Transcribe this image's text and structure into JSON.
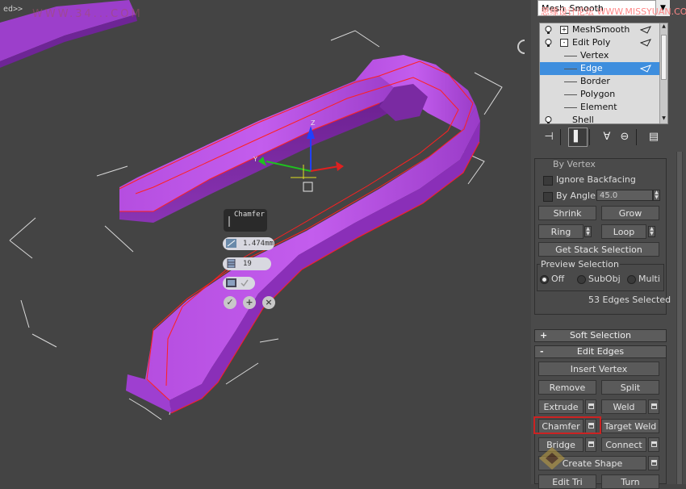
{
  "viewport": {
    "label": "ed>>",
    "watermark": "WWW.34...COM",
    "caddy": {
      "title": "Chamfer",
      "amount": "1.474mm",
      "segments": "19"
    }
  },
  "panel": {
    "name_box": "Mesh_Smooth",
    "watermark": "思缘设计论坛 WWW.MISSYUAN.COM",
    "stack": [
      {
        "label": "MeshSmooth",
        "level": 0,
        "pm": "+",
        "bulb": true,
        "pin": true
      },
      {
        "label": "Edit Poly",
        "level": 0,
        "pm": "-",
        "bulb": true,
        "pin": true
      },
      {
        "label": "Vertex",
        "level": 1
      },
      {
        "label": "Edge",
        "level": 1,
        "selected": true,
        "pin": true
      },
      {
        "label": "Border",
        "level": 1
      },
      {
        "label": "Polygon",
        "level": 1
      },
      {
        "label": "Element",
        "level": 1
      },
      {
        "label": "Shell",
        "level": 0,
        "bulb": true
      }
    ],
    "selection": {
      "by_vertex": "By Vertex",
      "ignore_backfacing": "Ignore Backfacing",
      "by_angle": "By Angle:",
      "angle_value": "45.0",
      "shrink": "Shrink",
      "grow": "Grow",
      "ring": "Ring",
      "loop": "Loop",
      "get_stack_selection": "Get Stack Selection",
      "preview_selection": "Preview Selection",
      "preview_options": [
        "Off",
        "SubObj",
        "Multi"
      ],
      "preview_selected": "Off",
      "status": "53 Edges Selected"
    },
    "soft_selection": {
      "sign": "+",
      "title": "Soft Selection"
    },
    "edit_edges": {
      "sign": "-",
      "title": "Edit Edges",
      "insert_vertex": "Insert Vertex",
      "remove": "Remove",
      "split": "Split",
      "extrude": "Extrude",
      "weld": "Weld",
      "chamfer": "Chamfer",
      "target_weld": "Target Weld",
      "bridge": "Bridge",
      "connect": "Connect",
      "create_shape": "Create Shape",
      "edit_tri": "Edit Tri",
      "turn": "Turn"
    }
  },
  "colors": {
    "viewport_bg": "#444444",
    "object": "#b04ad6",
    "edge_selected": "#ff2020",
    "stack_selected": "#3e8ede",
    "highlight": "#cc2222"
  }
}
